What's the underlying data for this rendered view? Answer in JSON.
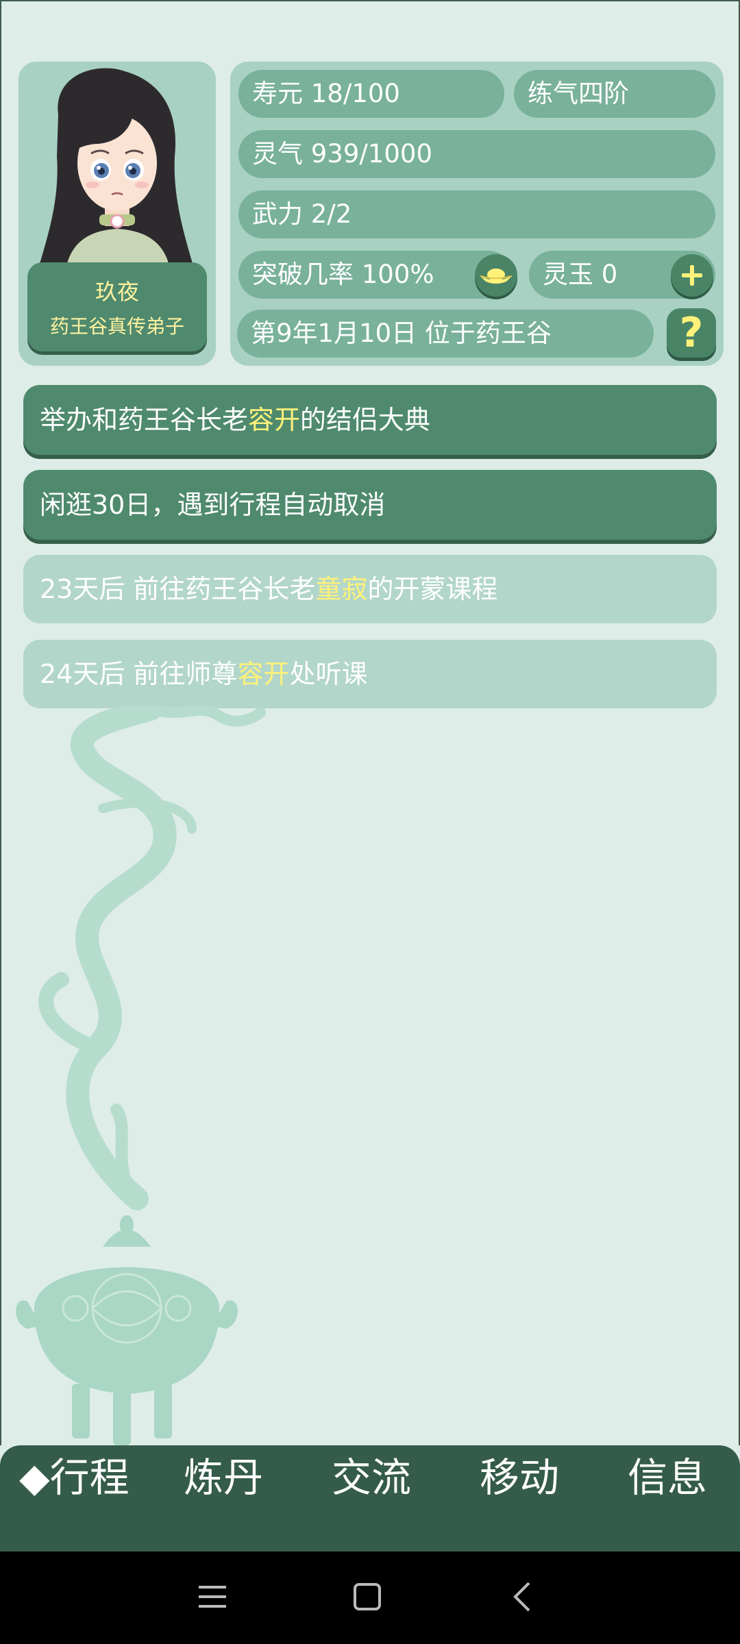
{
  "character": {
    "name": "玖夜",
    "title": "药王谷真传弟子"
  },
  "stats": {
    "lifespan": "寿元 18/100",
    "realm": "练气四阶",
    "spirit_qi": "灵气 939/1000",
    "martial_power": "武力 2/2",
    "breakthrough_chance": "突破几率 100%",
    "spirit_jade": "灵玉 0",
    "date_location": "第9年1月10日 位于药王谷",
    "help_symbol": "?",
    "add_symbol": "+"
  },
  "schedule": [
    {
      "prefix": "举办和药王谷长老",
      "highlight": "容开",
      "suffix": "的结侣大典",
      "state": "active"
    },
    {
      "prefix": "闲逛30日，遇到行程自动取消",
      "highlight": "",
      "suffix": "",
      "state": "active"
    },
    {
      "prefix": "23天后 前往药王谷长老",
      "highlight": "童寂",
      "suffix": "的开蒙课程",
      "state": "upcoming"
    },
    {
      "prefix": "24天后 前往师尊",
      "highlight": "容开",
      "suffix": "处听课",
      "state": "upcoming"
    }
  ],
  "nav": {
    "items": [
      {
        "label": "◆行程",
        "selected": true
      },
      {
        "label": "炼丹",
        "selected": false
      },
      {
        "label": "交流",
        "selected": false
      },
      {
        "label": "移动",
        "selected": false
      },
      {
        "label": "信息",
        "selected": false
      }
    ]
  },
  "icons": {
    "breakthrough_button": "ingot-icon",
    "jade_button": "plus-icon",
    "help_button": "question-icon",
    "system_menu": "menu-icon",
    "system_home": "home-icon",
    "system_back": "back-icon"
  },
  "colors": {
    "background": "#deede7",
    "panel": "#a8d1c3",
    "pill": "#79b19b",
    "active_task": "#4f8a6e",
    "upcoming_task": "#b2d6c9",
    "highlight": "#fff27a",
    "nav_bar": "#355b4a"
  }
}
